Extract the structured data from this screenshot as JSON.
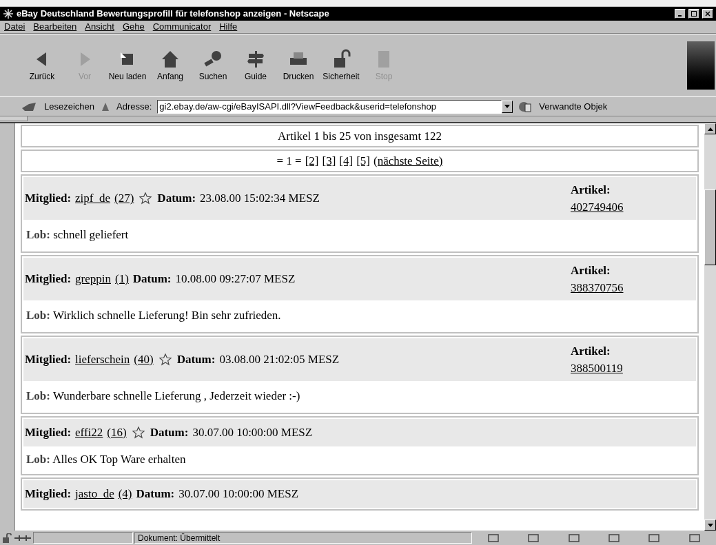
{
  "window": {
    "title": "eBay Deutschland Bewertungsprofill für telefonshop anzeigen - Netscape"
  },
  "menu": [
    "Datei",
    "Bearbeiten",
    "Ansicht",
    "Gehe",
    "Communicator",
    "Hilfe"
  ],
  "toolbar": [
    {
      "label": "Zurück",
      "kind": "back",
      "disabled": false
    },
    {
      "label": "Vor",
      "kind": "forward",
      "disabled": true
    },
    {
      "label": "Neu laden",
      "kind": "reload",
      "disabled": false
    },
    {
      "label": "Anfang",
      "kind": "home",
      "disabled": false
    },
    {
      "label": "Suchen",
      "kind": "search",
      "disabled": false
    },
    {
      "label": "Guide",
      "kind": "guide",
      "disabled": false
    },
    {
      "label": "Drucken",
      "kind": "print",
      "disabled": false
    },
    {
      "label": "Sicherheit",
      "kind": "security",
      "disabled": false
    },
    {
      "label": "Stop",
      "kind": "stop",
      "disabled": true
    }
  ],
  "location": {
    "bookmarks": "Lesezeichen",
    "address_label": "Adresse:",
    "address": "gi2.ebay.de/aw-cgi/eBayISAPI.dll?ViewFeedback&userid=telefonshop",
    "related": "Verwandte Objek"
  },
  "summary": "Artikel 1 bis 25 von insgesamt 122",
  "pagination": {
    "current": "= 1 =",
    "pages": [
      "[2]",
      "[3]",
      "[4]",
      "[5]",
      "(nächste Seite)"
    ]
  },
  "feedback": [
    {
      "member_label": "Mitglied:",
      "member": "zipf_de",
      "score": "(27)",
      "star": true,
      "date_label": "Datum:",
      "date": "23.08.00 15:02:34 MESZ",
      "article_label": "Artikel:",
      "article": "402749406",
      "comment_label": "Lob:",
      "comment": "schnell geliefert"
    },
    {
      "member_label": "Mitglied:",
      "member": "greppin",
      "score": "(1)",
      "star": false,
      "date_label": "Datum:",
      "date": "10.08.00 09:27:07 MESZ",
      "article_label": "Artikel:",
      "article": "388370756",
      "comment_label": "Lob:",
      "comment": "Wirklich schnelle Lieferung! Bin sehr zufrieden."
    },
    {
      "member_label": "Mitglied:",
      "member": "lieferschein",
      "score": "(40)",
      "star": true,
      "date_label": "Datum:",
      "date": "03.08.00 21:02:05 MESZ",
      "article_label": "Artikel:",
      "article": "388500119",
      "comment_label": "Lob:",
      "comment": "Wunderbare schnelle Lieferung , Jederzeit wieder :-)"
    },
    {
      "member_label": "Mitglied:",
      "member": "effi22",
      "score": "(16)",
      "star": true,
      "date_label": "Datum:",
      "date": "30.07.00 10:00:00 MESZ",
      "comment_label": "Lob:",
      "comment": "Alles OK Top Ware erhalten"
    },
    {
      "member_label": "Mitglied:",
      "member": "jasto_de",
      "score": "(4)",
      "star": false,
      "date_label": "Datum:",
      "date": "30.07.00 10:00:00 MESZ"
    }
  ],
  "status_bar": {
    "text": "Dokument: Übermittelt"
  }
}
